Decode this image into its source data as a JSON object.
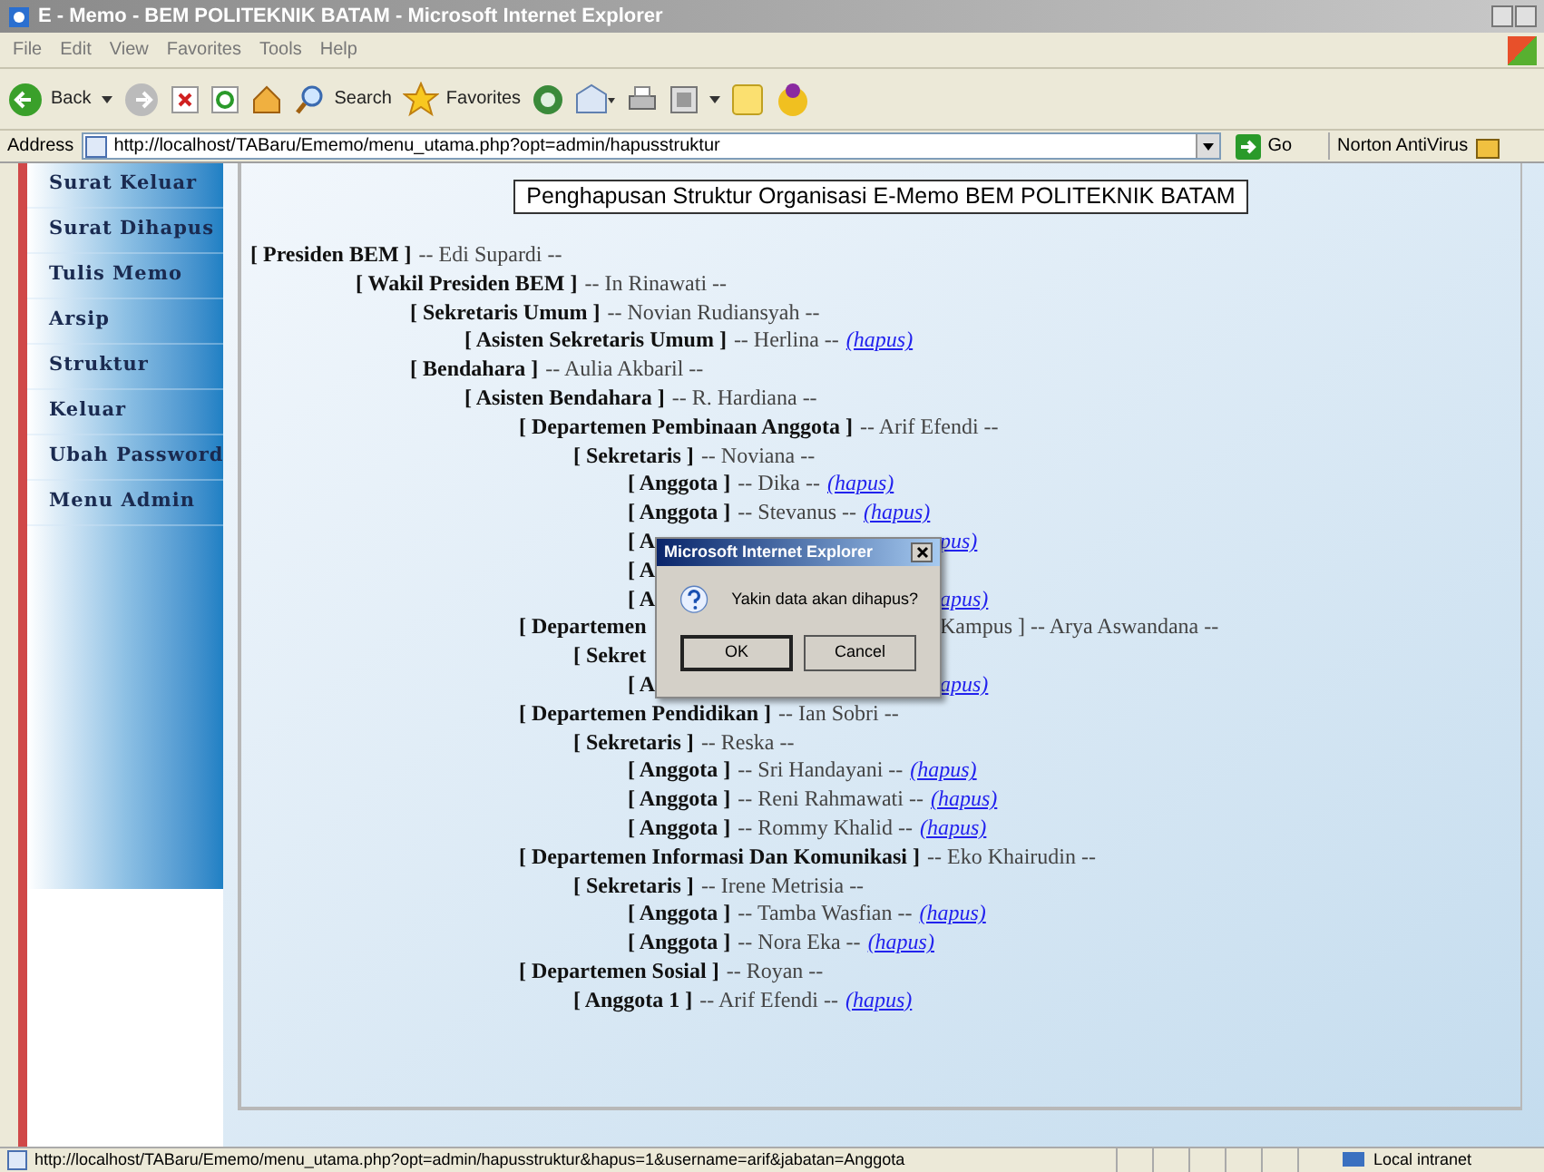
{
  "window": {
    "title": "E - Memo - BEM POLITEKNIK BATAM - Microsoft Internet Explorer"
  },
  "menu_bar": [
    "File",
    "Edit",
    "View",
    "Favorites",
    "Tools",
    "Help"
  ],
  "toolbar": {
    "back": "Back",
    "search": "Search",
    "favorites": "Favorites"
  },
  "address_bar": {
    "label": "Address",
    "value": "http://localhost/TABaru/Ememo/menu_utama.php?opt=admin/hapusstruktur",
    "go": "Go",
    "norton": "Norton AntiVirus"
  },
  "sidebar": {
    "items": [
      "Surat Keluar",
      "Surat Dihapus",
      "Tulis Memo",
      "Arsip",
      "Struktur",
      "Keluar",
      "Ubah Password",
      "Menu Admin"
    ]
  },
  "page_title": "Penghapusan Struktur Organisasi E-Memo BEM POLITEKNIK BATAM",
  "tree": [
    {
      "kind": "entry",
      "role": "[ Presiden BEM ]",
      "name": "-- Edi Supardi --",
      "children": [
        {
          "kind": "entry",
          "role": "[ Wakil Presiden BEM ]",
          "name": "-- In Rinawati --",
          "children": [
            {
              "kind": "entry",
              "role": "[ Sekretaris Umum ]",
              "name": "-- Novian Rudiansyah --",
              "children": [
                {
                  "kind": "entry",
                  "role": "[ Asisten Sekretaris Umum ]",
                  "name": "-- Herlina --",
                  "link": "(hapus)"
                }
              ]
            },
            {
              "kind": "entry",
              "role": "[ Bendahara ]",
              "name": "-- Aulia Akbaril --",
              "children": [
                {
                  "kind": "entry",
                  "role": "[ Asisten Bendahara ]",
                  "name": "-- R. Hardiana --",
                  "children": [
                    {
                      "kind": "entry",
                      "role": "[ Departemen Pembinaan Anggota ]",
                      "name": "-- Arif Efendi --",
                      "children": [
                        {
                          "kind": "entry",
                          "role": "[ Sekretaris ]",
                          "name": "-- Noviana --",
                          "children": [
                            {
                              "kind": "entry",
                              "role": "[ Anggota ]",
                              "name": "-- Dika --",
                              "link": "(hapus)"
                            },
                            {
                              "kind": "entry",
                              "role": "[ Anggota ]",
                              "name": "-- Stevanus --",
                              "link": "(hapus)"
                            },
                            {
                              "kind": "partial",
                              "left": "[ A",
                              "right_link": "pus)"
                            },
                            {
                              "kind": "partial",
                              "left": "[ A"
                            },
                            {
                              "kind": "partial",
                              "left": "[ A",
                              "right_link": "apus)"
                            }
                          ]
                        }
                      ]
                    },
                    {
                      "kind": "partial",
                      "left": "[ Departemen",
                      "right": "Kampus ] -- Arya Aswandana --",
                      "children": [
                        {
                          "kind": "partial",
                          "left": "[ Sekret",
                          "children": [
                            {
                              "kind": "partial",
                              "left": "[ A",
                              "right_link": "apus)"
                            }
                          ]
                        }
                      ]
                    },
                    {
                      "kind": "entry",
                      "role": "[ Departemen Pendidikan ]",
                      "name": "-- Ian Sobri --",
                      "children": [
                        {
                          "kind": "entry",
                          "role": "[ Sekretaris ]",
                          "name": "-- Reska --",
                          "children": [
                            {
                              "kind": "entry",
                              "role": "[ Anggota ]",
                              "name": "-- Sri Handayani --",
                              "link": "(hapus)"
                            },
                            {
                              "kind": "entry",
                              "role": "[ Anggota ]",
                              "name": "-- Reni Rahmawati --",
                              "link": "(hapus)"
                            },
                            {
                              "kind": "entry",
                              "role": "[ Anggota ]",
                              "name": "-- Rommy Khalid --",
                              "link": "(hapus)"
                            }
                          ]
                        }
                      ]
                    },
                    {
                      "kind": "entry",
                      "role": "[ Departemen Informasi Dan Komunikasi ]",
                      "name": "-- Eko Khairudin --",
                      "children": [
                        {
                          "kind": "entry",
                          "role": "[ Sekretaris ]",
                          "name": "-- Irene Metrisia --",
                          "children": [
                            {
                              "kind": "entry",
                              "role": "[ Anggota ]",
                              "name": "-- Tamba Wasfian --",
                              "link": "(hapus)"
                            },
                            {
                              "kind": "entry",
                              "role": "[ Anggota ]",
                              "name": "-- Nora Eka --",
                              "link": "(hapus)"
                            }
                          ]
                        }
                      ]
                    },
                    {
                      "kind": "entry",
                      "role": "[ Departemen Sosial ]",
                      "name": "-- Royan --",
                      "children": [
                        {
                          "kind": "entry",
                          "role": "[ Anggota 1 ]",
                          "name": "-- Arif Efendi --",
                          "link": "(hapus)"
                        }
                      ]
                    }
                  ]
                }
              ]
            }
          ]
        }
      ]
    }
  ],
  "dialog": {
    "title": "Microsoft Internet Explorer",
    "message": "Yakin data akan dihapus?",
    "buttons": [
      "OK",
      "Cancel"
    ]
  },
  "status_bar": {
    "url": "http://localhost/TABaru/Ememo/menu_utama.php?opt=admin/hapusstruktur&hapus=1&username=arif&jabatan=Anggota",
    "zone": "Local intranet"
  }
}
